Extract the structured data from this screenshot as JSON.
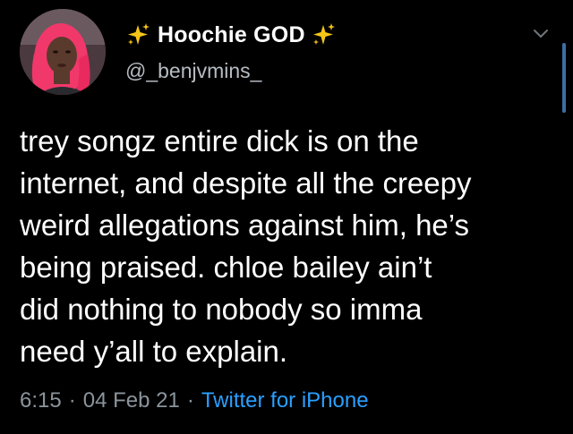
{
  "author": {
    "display_name": "Hoochie GOD",
    "handle": "@_benjvmins_",
    "left_emoji": "sparkles-icon",
    "right_emoji": "sparkles-icon"
  },
  "tweet": {
    "text": "trey songz entire dick is on the\ninternet, and despite all the creepy\nweird allegations against him, he’s\nbeing praised. chloe bailey ain’t\ndid nothing to nobody so imma\nneed y’all to explain.",
    "time": "6:15",
    "date": "04 Feb 21",
    "separator": "·",
    "source": "Twitter for iPhone"
  },
  "colors": {
    "background": "#000000",
    "text": "#ffffff",
    "meta": "#8b949c",
    "link": "#2aa0ff",
    "sparkle": "#f5c518"
  }
}
